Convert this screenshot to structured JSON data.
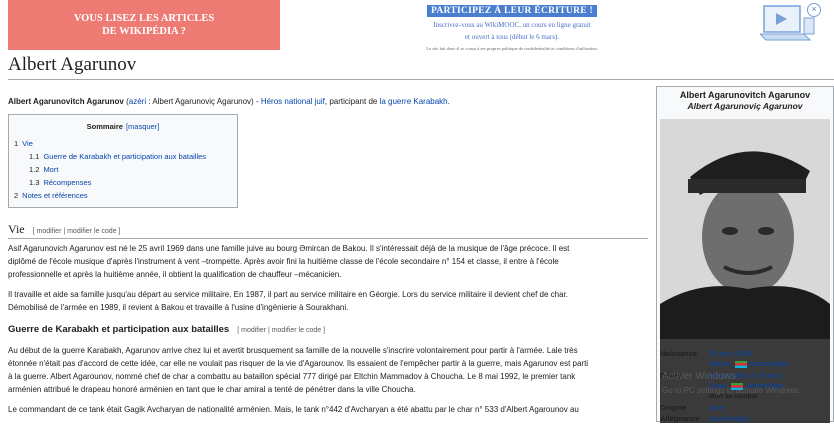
{
  "banner": {
    "left_line1": "VOUS LISEZ LES ARTICLES",
    "left_line2": "DE WIKIPÉDIA ?",
    "cta": "PARTICIPEZ À LEUR ÉCRITURE !",
    "sub_line1": "Inscrivez-vous au WikiMOOC, un cours en ligne gratuit",
    "sub_line2": "et ouvert à tous (début le 6 mars).",
    "fine": "Le site fait donc-il se conçu à ses propres politique de confidentialité et conditions d'utilisation."
  },
  "title": "Albert Agarunov",
  "intro": {
    "name": "Albert Agarunovitch Agarunov",
    "p1": " (",
    "azeri": "azéri",
    "p2": " : Albert Agarunoviç Agarunov) - ",
    "hero": "Héros national juif",
    "p3": ", participant de ",
    "war": "la guerre Karabakh",
    "p4": "."
  },
  "toc": {
    "title": "Sommaire",
    "toggle": "[masquer]",
    "items": [
      {
        "num": "1",
        "label": "Vie"
      },
      {
        "num": "1.1",
        "label": "Guerre de Karabakh et participation aux batailles"
      },
      {
        "num": "1.2",
        "label": "Mort"
      },
      {
        "num": "1.3",
        "label": "Récompenses"
      },
      {
        "num": "2",
        "label": "Notes et références"
      }
    ]
  },
  "section_vie": {
    "title": "Vie",
    "edit": "[ modifier | modifier le code ]",
    "p1_l1": "Asif Agarunovich Agarunov est né le 25 avril 1969 dans une famille juive au bourg Əmircan de Bakou. Il s'intéressait déjà de la musique de l'âge précoce. Il est",
    "p1_l2": "diplômé de l'école musique d'après l'instrument à vent –trompette. Après avoir fini la huitième classe de l'école secondaire n° 154 et classe, il entre à l'école",
    "p1_l3": "professionnelle et après la huitième année, il obtient la qualification de chauffeur –mécanicien.",
    "p2_l1": "Il travaille et aide sa famille jusqu'au départ au service militaire. En 1987, il part au service militaire en Géorgie. Lors du service militaire il devient chef de char.",
    "p2_l2": "Démobilisé de l'armée en 1989, il revient à Bakou et travaille à l'usine d'ingénierie à Sourakhani."
  },
  "section_guerre": {
    "title": "Guerre de Karabakh et participation aux batailles",
    "edit": "[ modifier | modifier le code ]",
    "p1_l1": "Au début de la guerre Karabakh, Agarunov arrive chez lui et avertit brusquement sa famille de la nouvelle s'inscrire volontairement pour partir à l'armée. Lale très",
    "p1_l2": "étonnée n'était pas d'accord de cette idée, car elle ne voulait pas risquer de la vie d'Agarounov. Ils essaient de l'empêcher partir à la guerre, mais Agarunov est parti",
    "p1_l3": "à la guerre. Albert Agarounov, nommé chef de char a combattu au bataillon spécial 777 dirigé par Eltchin Mammadov à Choucha. Le 8 mai 1992, le premier tank",
    "p1_l4": "arménien attribué le drapeau honoré arménien en tant que le char amiral a tenté de pénétrer dans la ville Choucha.",
    "p2_l1": "Le commandant de ce tank était Gagik Avcharyan de nationalité arménien. Mais, le tank n°442 d'Avcharyan a été abattu par le char n° 533 d'Albert Agarounov au"
  },
  "infobox": {
    "name": "Albert Agarunovitch Agarunov",
    "native_name": "Albert Agarunoviç Agarunov",
    "birth_label": "Naissance",
    "birth_date": "25 avril 1969",
    "birth_place": "Bakou,",
    "birth_country": "Azerbaïdjan",
    "death_label": "Décès",
    "death_date": "8 mai 1992 (à 23 ans)",
    "death_place": "Şuşa,",
    "death_country": "Azerbaïdjan",
    "death_note": "Mort au combat",
    "origin_label": "Origine",
    "origin": "juive",
    "allegiance_label": "Allégeance",
    "allegiance": "Azerbaïdjan"
  },
  "watermark": {
    "line1": "Activer Windows",
    "line2": "Go to PC settings to activate Windows."
  },
  "colors": {
    "link": "#0645ad",
    "banner_left": "#ed7b73",
    "cta": "#4a7fd0"
  }
}
